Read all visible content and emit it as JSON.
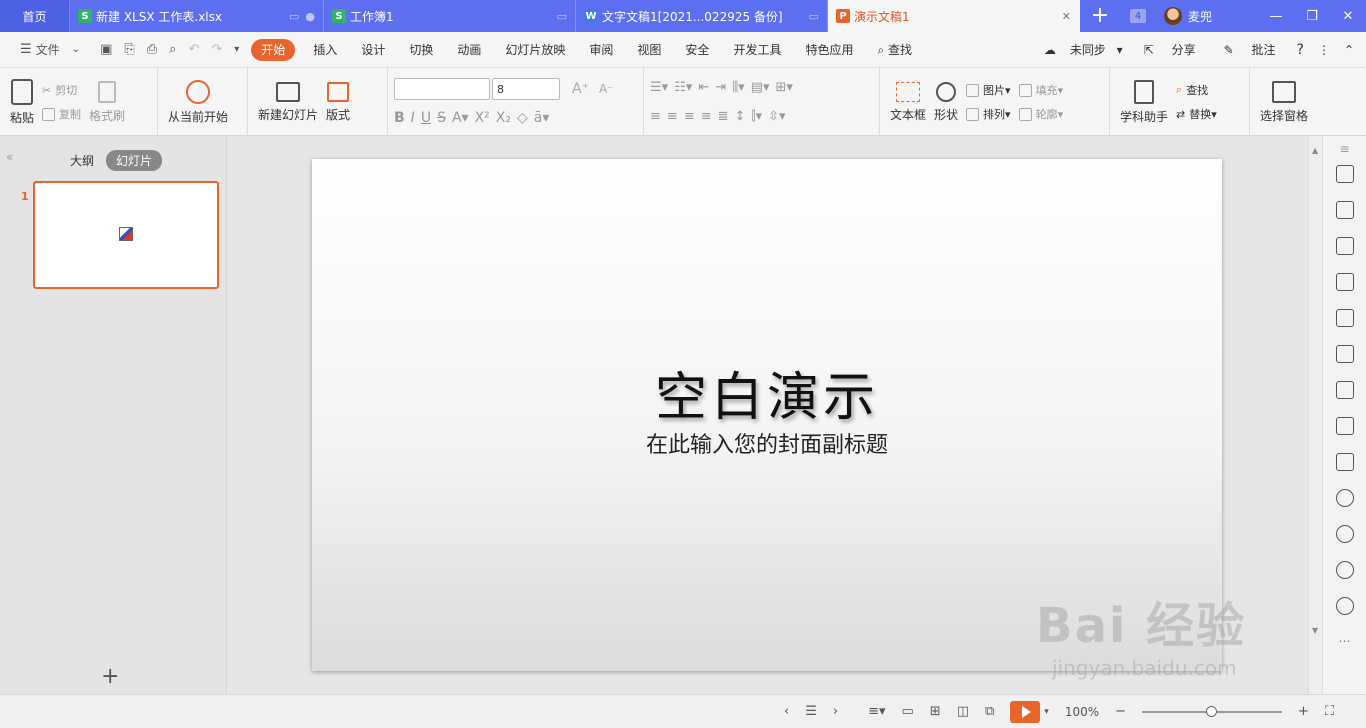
{
  "tabs": {
    "home": "首页",
    "items": [
      {
        "label": "新建 XLSX 工作表.xlsx",
        "icon": "S",
        "color": "#2fb568"
      },
      {
        "label": "工作簿1",
        "icon": "S",
        "color": "#2fb568"
      },
      {
        "label": "文字文稿1[2021...022925 备份]",
        "icon": "W",
        "color": "#3f7ce6"
      },
      {
        "label": "演示文稿1",
        "icon": "P",
        "color": "#e8642d"
      }
    ],
    "new_tab": "+",
    "window_count": "4",
    "username": "麦兜"
  },
  "menu": {
    "file": "文件",
    "items": [
      "开始",
      "插入",
      "设计",
      "切换",
      "动画",
      "幻灯片放映",
      "审阅",
      "视图",
      "安全",
      "开发工具",
      "特色应用"
    ],
    "search": "查找",
    "sync": "未同步",
    "share": "分享",
    "comment": "批注",
    "help": "?"
  },
  "ribbon": {
    "paste": "粘贴",
    "cut": "剪切",
    "copy": "复制",
    "format_painter": "格式刷",
    "play_from_current": "从当前开始",
    "new_slide": "新建幻灯片",
    "layout": "版式",
    "font_name": "",
    "font_size": "8",
    "textbox": "文本框",
    "shape": "形状",
    "picture": "图片",
    "arrange": "排列",
    "fill": "填充",
    "outline": "轮廓",
    "study_assistant": "学科助手",
    "find": "查找",
    "replace": "替换",
    "selection_pane": "选择窗格"
  },
  "left_pane": {
    "outline_tab": "大纲",
    "slides_tab": "幻灯片",
    "slide_number": "1",
    "add_slide": "+"
  },
  "slide": {
    "title": "空白演示",
    "subtitle": "在此输入您的封面副标题"
  },
  "status": {
    "zoom": "100%"
  },
  "watermark": {
    "brand": "Bai 经验",
    "url": "jingyan.baidu.com"
  }
}
